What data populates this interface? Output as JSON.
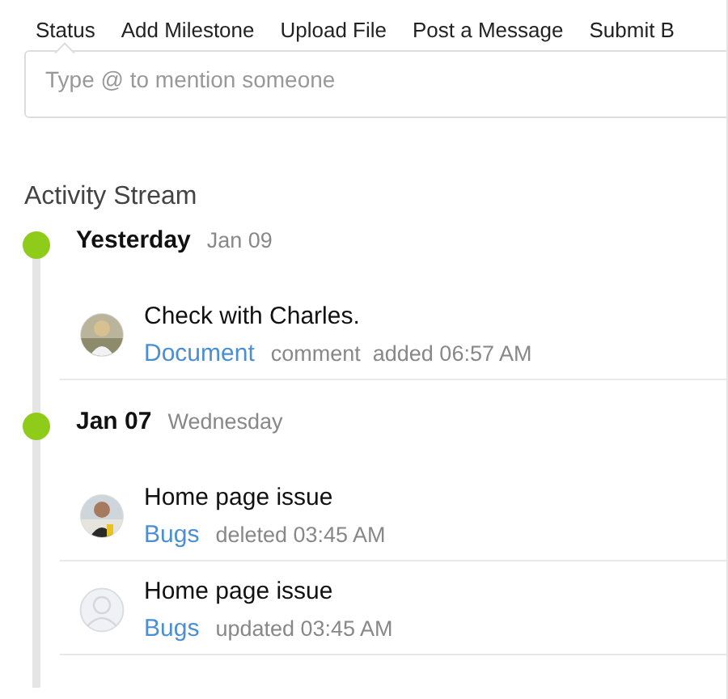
{
  "tabs": [
    {
      "label": "Status",
      "selected": true
    },
    {
      "label": "Add Milestone",
      "selected": false
    },
    {
      "label": "Upload File",
      "selected": false
    },
    {
      "label": "Post a Message",
      "selected": false
    },
    {
      "label": "Submit B",
      "selected": false
    }
  ],
  "composer": {
    "placeholder": "Type @ to mention someone"
  },
  "activity_stream": {
    "title": "Activity Stream",
    "groups": [
      {
        "day": "Yesterday",
        "date": "Jan 09",
        "items": [
          {
            "title": "Check with Charles.",
            "link": "Document",
            "meta": "comment  added 06:57 AM"
          }
        ]
      },
      {
        "day": "Jan 07",
        "date": "Wednesday",
        "items": [
          {
            "title": "Home page issue",
            "link": "Bugs",
            "meta": "deleted 03:45 AM"
          },
          {
            "title": "Home page issue",
            "link": "Bugs",
            "meta": "updated 03:45 AM",
            "kind": "placeholder"
          }
        ]
      }
    ]
  }
}
